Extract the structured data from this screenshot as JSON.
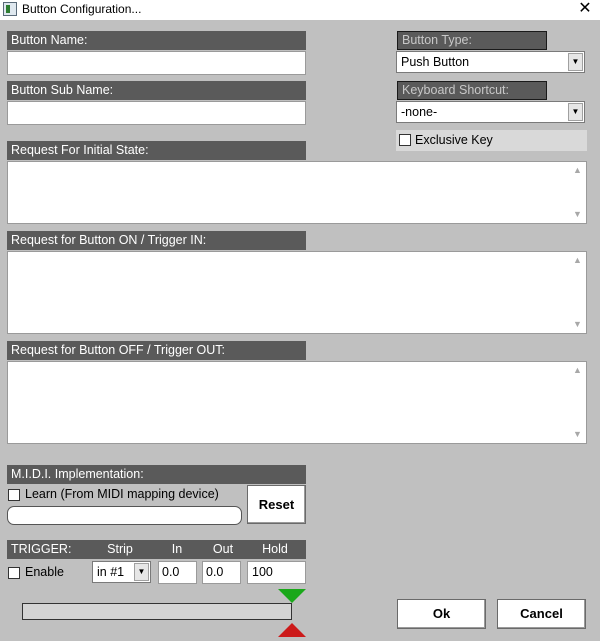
{
  "window": {
    "title": "Button Configuration...",
    "close": "✕"
  },
  "fields": {
    "button_name": {
      "label": "Button Name:",
      "value": ""
    },
    "button_sub_name": {
      "label": "Button Sub Name:",
      "value": ""
    },
    "button_type": {
      "label": "Button Type:",
      "value": "Push Button"
    },
    "keyboard_shortcut": {
      "label": "Keyboard Shortcut:",
      "value": "-none-"
    },
    "exclusive_key": {
      "label": "Exclusive Key",
      "checked": false
    }
  },
  "requests": {
    "initial": {
      "label": "Request For Initial State:",
      "value": ""
    },
    "on": {
      "label": "Request for Button ON / Trigger IN:",
      "value": ""
    },
    "off": {
      "label": "Request for Button OFF / Trigger OUT:",
      "value": ""
    }
  },
  "midi": {
    "label": "M.I.D.I. Implementation:",
    "learn_label": "Learn (From MIDI mapping device)",
    "learn_checked": false,
    "value": "",
    "reset_label": "Reset"
  },
  "trigger": {
    "label": "TRIGGER:",
    "col_strip": "Strip",
    "col_in": "In",
    "col_out": "Out",
    "col_hold": "Hold",
    "enable_label": "Enable",
    "enable_checked": false,
    "strip_value": "in #1",
    "in_value": "0.0",
    "out_value": "0.0",
    "hold_value": "100",
    "level": 0
  },
  "buttons": {
    "ok": "Ok",
    "cancel": "Cancel"
  },
  "icons": {
    "dropdown": "▼",
    "scroll_up": "▲",
    "scroll_down": "▼"
  },
  "colors": {
    "header_bg": "#5a5a5a",
    "window_bg": "#c0c0c0",
    "marker_in": "#1aa81a",
    "marker_out": "#cc1a1a"
  }
}
